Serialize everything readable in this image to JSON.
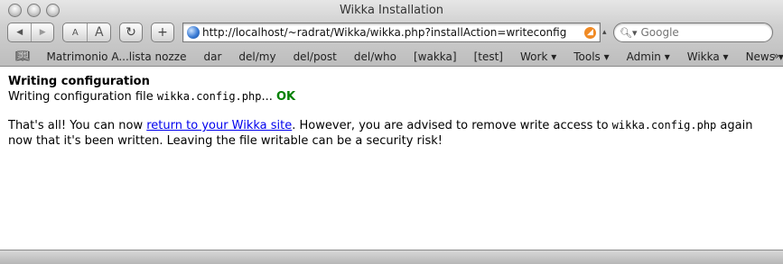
{
  "window": {
    "title": "Wikka Installation"
  },
  "toolbar": {
    "back_label": "◀",
    "forward_label": "▶",
    "text_smaller_label": "A",
    "text_bigger_label": "A",
    "reload_label": "↻",
    "add_bookmark_label": "+",
    "url": "http://localhost/~radrat/Wikka/wikka.php?installAction=writeconfig",
    "search_placeholder": "Google"
  },
  "bookmarks": {
    "items": [
      "Matrimonio A...lista nozze",
      "dar",
      "del/my",
      "del/post",
      "del/who",
      "[wakka]",
      "[test]",
      "Work ▾",
      "Tools ▾",
      "Admin ▾",
      "Wikka ▾",
      "News ▾"
    ],
    "more_label": "»"
  },
  "content": {
    "heading": "Writing configuration",
    "status_prefix": "Writing configuration file ",
    "config_file": "wikka.config.php",
    "status_ellipsis": "...",
    "status_result": "OK",
    "para_start": "That's all! You can now ",
    "link_text": "return to your Wikka site",
    "para_middle": ". However, you are advised to remove write access to ",
    "para_file": "wikka.config.php",
    "para_end": " again now that it's been written. Leaving the file writable can be a security risk!"
  },
  "colors": {
    "ok": "#008000",
    "link": "#0000ee"
  }
}
